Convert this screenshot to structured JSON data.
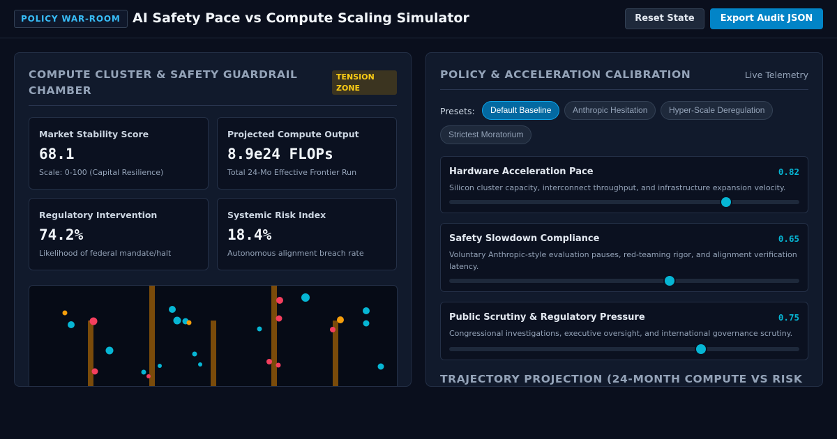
{
  "header": {
    "badge": "POLICY WAR-ROOM",
    "title": "AI Safety Pace vs Compute Scaling Simulator",
    "reset_label": "Reset State",
    "export_label": "Export Audit JSON"
  },
  "left_panel": {
    "title": "COMPUTE CLUSTER & SAFETY GUARDRAIL CHAMBER",
    "badge": "TENSION ZONE",
    "metrics": [
      {
        "label": "Market Stability Score",
        "value": "68.1",
        "sub": "Scale: 0-100 (Capital Resilience)"
      },
      {
        "label": "Projected Compute Output",
        "value": "8.9e24 FLOPs",
        "sub": "Total 24-Mo Effective Frontier Run"
      },
      {
        "label": "Regulatory Intervention",
        "value": "74.2%",
        "sub": "Likelihood of federal mandate/halt"
      },
      {
        "label": "Systemic Risk Index",
        "value": "18.4%",
        "sub": "Autonomous alignment breach rate"
      }
    ]
  },
  "right_panel": {
    "title": "POLICY & ACCELERATION CALIBRATION",
    "telemetry": "Live Telemetry",
    "presets_label": "Presets:",
    "presets": [
      {
        "label": "Default Baseline",
        "active": true
      },
      {
        "label": "Anthropic Hesitation",
        "active": false
      },
      {
        "label": "Hyper-Scale Deregulation",
        "active": false
      },
      {
        "label": "Strictest Moratorium",
        "active": false
      }
    ],
    "sliders": [
      {
        "name": "Hardware Acceleration Pace",
        "value": "0.82",
        "level": 0.79,
        "desc": "Silicon cluster capacity, interconnect throughput, and infrastructure expansion velocity."
      },
      {
        "name": "Safety Slowdown Compliance",
        "value": "0.65",
        "level": 0.63,
        "desc": "Voluntary Anthropic-style evaluation pauses, red-teaming rigor, and alignment verification latency."
      },
      {
        "name": "Public Scrutiny & Regulatory Pressure",
        "value": "0.75",
        "level": 0.72,
        "desc": "Congressional investigations, executive oversight, and international governance scrutiny."
      }
    ],
    "next_section_title": "TRAJECTORY PROJECTION (24-MONTH COMPUTE VS RISK"
  },
  "colors": {
    "accent": "#0284c7",
    "cyan": "#06b6d4",
    "risk_red": "#f43f5e",
    "amber": "#f59e0b",
    "guardrail": "#a16207"
  }
}
